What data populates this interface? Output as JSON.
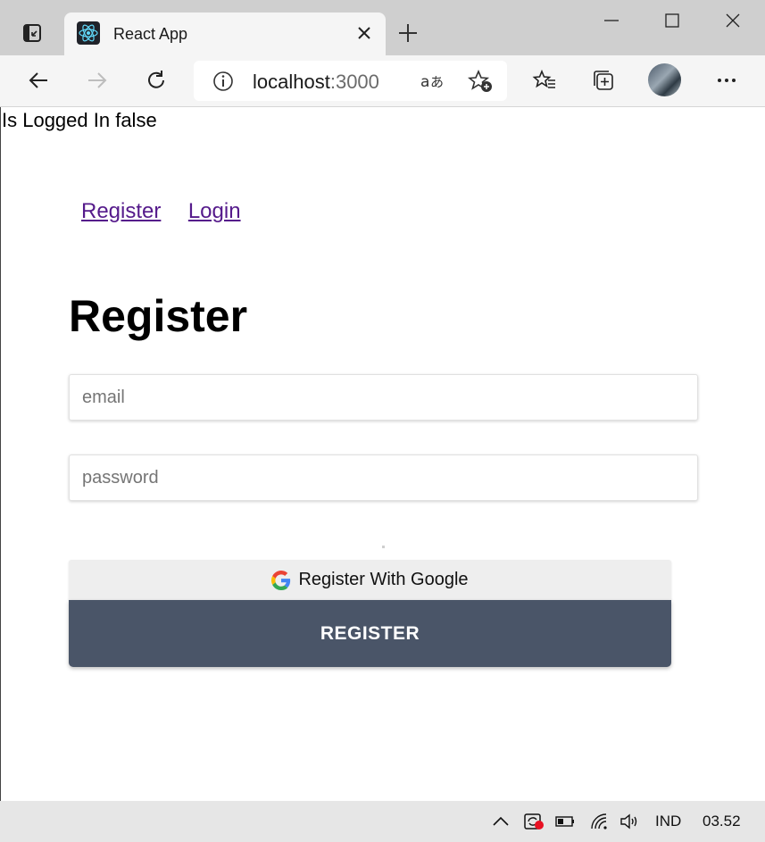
{
  "browser": {
    "tab_title": "React App",
    "url_host": "localhost",
    "url_port": ":3000"
  },
  "page": {
    "status_text": "Is Logged In false",
    "nav": {
      "register_link": "Register",
      "login_link": "Login"
    },
    "heading": "Register",
    "email_placeholder": "email",
    "password_placeholder": "password",
    "google_button_label": "Register With Google",
    "register_button_label": "REGISTER",
    "colors": {
      "link": "#551a8b",
      "register_button": "#4a5568",
      "google_button": "#eeeeee"
    }
  },
  "taskbar": {
    "language": "IND",
    "clock": "03.52"
  }
}
